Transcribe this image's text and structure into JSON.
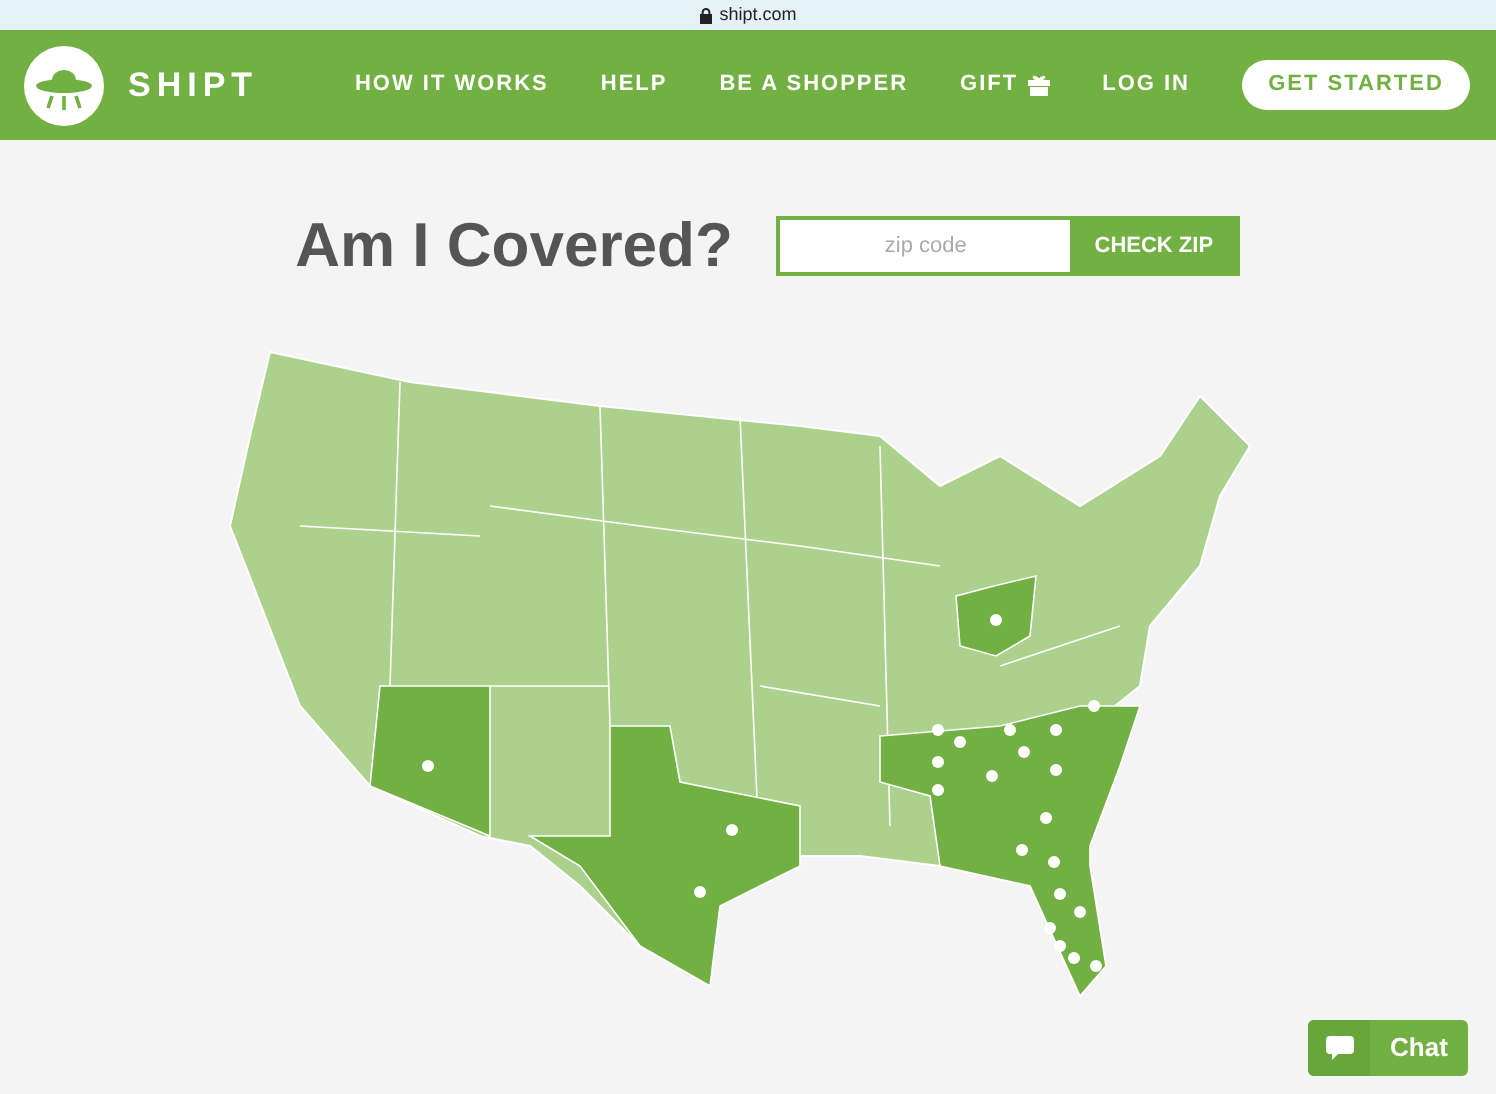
{
  "browser": {
    "address": "shipt.com"
  },
  "header": {
    "logo": "SHIPT",
    "nav": [
      {
        "label": "HOW IT WORKS",
        "kind": "link"
      },
      {
        "label": "HELP",
        "kind": "link"
      },
      {
        "label": "BE A SHOPPER",
        "kind": "link"
      },
      {
        "label": "GIFT",
        "kind": "gift"
      },
      {
        "label": "LOG IN",
        "kind": "link"
      },
      {
        "label": "GET STARTED",
        "kind": "button"
      }
    ]
  },
  "coverage": {
    "title": "Am I Covered?",
    "zip": {
      "placeholder": "zip code"
    },
    "button": "CHECK ZIP"
  },
  "chat": {
    "label": "Chat"
  }
}
